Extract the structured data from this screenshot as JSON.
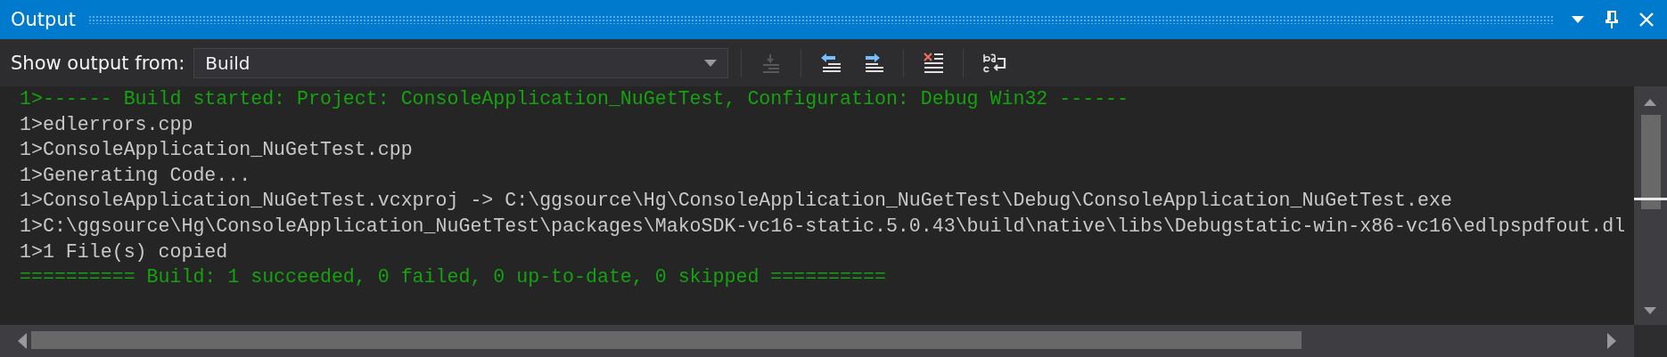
{
  "window": {
    "title": "Output"
  },
  "toolbar": {
    "label": "Show output from:",
    "source": {
      "value": "Build"
    },
    "buttons": [
      {
        "kind": "goto",
        "disabled": true
      },
      {
        "kind": "prev",
        "disabled": false
      },
      {
        "kind": "next",
        "disabled": false
      },
      {
        "kind": "clear",
        "disabled": false
      },
      {
        "kind": "wrap",
        "disabled": false
      }
    ]
  },
  "lines": [
    {
      "kind": "status",
      "text": "1>------ Build started: Project: ConsoleApplication_NuGetTest, Configuration: Debug Win32 ------"
    },
    {
      "kind": "plain",
      "text": "1>edlerrors.cpp"
    },
    {
      "kind": "plain",
      "text": "1>ConsoleApplication_NuGetTest.cpp"
    },
    {
      "kind": "plain",
      "text": "1>Generating Code..."
    },
    {
      "kind": "plain",
      "text": "1>ConsoleApplication_NuGetTest.vcxproj -> C:\\ggsource\\Hg\\ConsoleApplication_NuGetTest\\Debug\\ConsoleApplication_NuGetTest.exe"
    },
    {
      "kind": "plain",
      "text": "1>C:\\ggsource\\Hg\\ConsoleApplication_NuGetTest\\packages\\MakoSDK-vc16-static.5.0.43\\build\\native\\libs\\Debugstatic-win-x86-vc16\\edlpspdfout.dl"
    },
    {
      "kind": "plain",
      "text": "1>1 File(s) copied"
    },
    {
      "kind": "status",
      "text": "========== Build: 1 succeeded, 0 failed, 0 up-to-date, 0 skipped =========="
    }
  ]
}
